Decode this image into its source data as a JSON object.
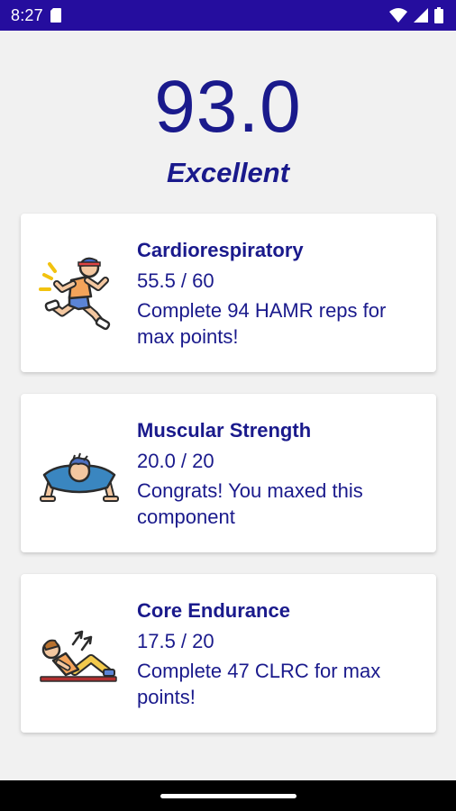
{
  "status_bar": {
    "time": "8:27",
    "icons": [
      "sim-card-icon",
      "wifi-icon",
      "cell-signal-icon",
      "battery-icon"
    ]
  },
  "summary": {
    "score": "93.0",
    "rating": "Excellent"
  },
  "components": [
    {
      "title": "Cardiorespiratory",
      "score": "55.5 / 60",
      "tip": "Complete 94 HAMR reps for max points!",
      "icon": "runner-icon"
    },
    {
      "title": "Muscular Strength",
      "score": "20.0 / 20",
      "tip": "Congrats! You maxed this component",
      "icon": "pushup-icon"
    },
    {
      "title": "Core Endurance",
      "score": "17.5 / 20",
      "tip": "Complete 47 CLRC for max points!",
      "icon": "curl-up-icon"
    }
  ],
  "colors": {
    "status_bar": "#250d9e",
    "text_primary": "#1a1a8c",
    "background": "#f1f1f1",
    "card": "#ffffff"
  }
}
